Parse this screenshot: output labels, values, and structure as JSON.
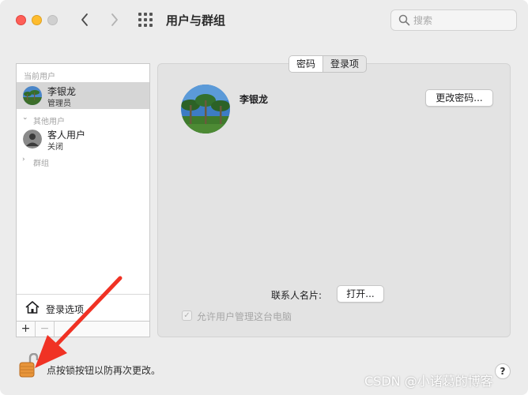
{
  "window": {
    "title": "用户与群组"
  },
  "search": {
    "placeholder": "搜索"
  },
  "sidebar": {
    "current_users_heading": "当前用户",
    "current_user": {
      "name": "李银龙",
      "role": "管理员"
    },
    "other_users_heading": "其他用户",
    "guest_user": {
      "name": "客人用户",
      "role": "关闭"
    },
    "groups_label": "群组",
    "login_options_label": "登录选项",
    "add_label": "+",
    "remove_label": "−"
  },
  "tabs": [
    {
      "label": "密码",
      "active": true
    },
    {
      "label": "登录项",
      "active": false
    }
  ],
  "main": {
    "user_name": "李银龙",
    "change_password_label": "更改密码...",
    "contact_card_label": "联系人名片:",
    "open_button_label": "打开...",
    "allow_admin_label": "允许用户管理这台电脑",
    "allow_admin_checked": true
  },
  "bottom": {
    "lock_text": "点按锁按钮以防再次更改。",
    "help_label": "?"
  },
  "watermark": "CSDN @小诸葛的博客",
  "colors": {
    "close": "#fe5f57",
    "minimize": "#febc2e",
    "annotation_arrow": "#f03224",
    "lock_body": "#e8953a"
  }
}
